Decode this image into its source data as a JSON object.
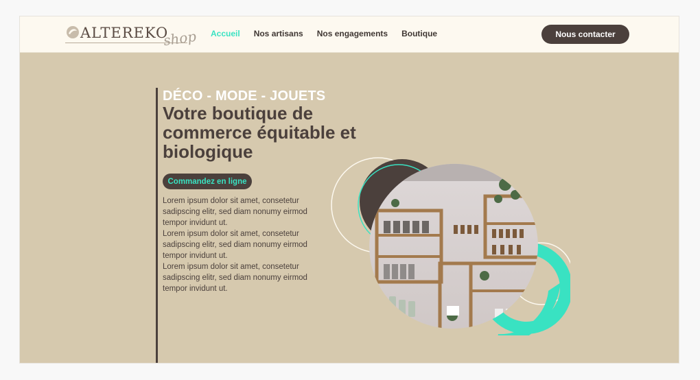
{
  "brand": {
    "name": "ALTEREKO",
    "script": "shop"
  },
  "nav": {
    "items": [
      {
        "label": "Accueil",
        "active": true
      },
      {
        "label": "Nos artisans",
        "active": false
      },
      {
        "label": "Nos engagements",
        "active": false
      },
      {
        "label": "Boutique",
        "active": false
      }
    ],
    "contact_label": "Nous contacter"
  },
  "hero": {
    "eyebrow": "DÉCO - MODE - JOUETS",
    "title": "Votre boutique de commerce équitable et biologique",
    "cta_label": "Commandez en ligne",
    "paragraphs": [
      "Lorem ipsum dolor sit amet, consetetur sadipscing elitr, sed diam nonumy eirmod tempor invidunt ut.",
      "Lorem ipsum dolor sit amet, consetetur sadipscing elitr, sed diam nonumy eirmod tempor invidunt ut.",
      "Lorem ipsum dolor sit amet, consetetur sadipscing elitr, sed diam nonumy eirmod tempor invidunt ut."
    ]
  },
  "icons": {
    "logo_mark": "leaf-logo-icon"
  },
  "colors": {
    "background": "#d6c9ae",
    "header": "#fdf9f0",
    "brown": "#4b403c",
    "accent": "#39e2c2",
    "white": "#ffffff"
  }
}
